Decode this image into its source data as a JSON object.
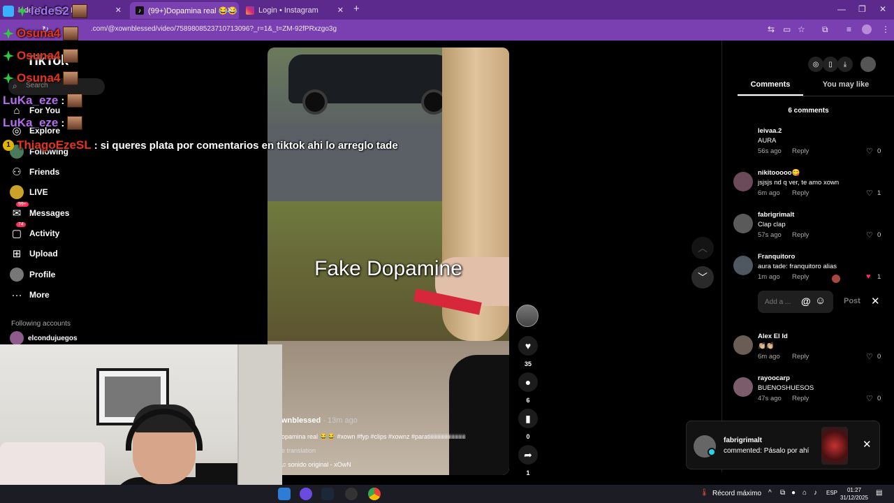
{
  "browser": {
    "tabs": [
      {
        "label": "ledeS2 · wlash L",
        "active": false
      },
      {
        "label": "(99+)Dopamina real 😂😂 #x",
        "active": true
      },
      {
        "label": "Login • Instagram",
        "active": false
      }
    ],
    "new_tab": "+",
    "url": ".com/@xownblessed/video/7589808523710713096?_r=1&_t=ZM-92fPRxzgo3g",
    "window_controls": [
      "—",
      "❐",
      "✕"
    ]
  },
  "chat": [
    {
      "name": "ledeS2",
      "color": "#a970ff",
      "message": ""
    },
    {
      "name": "Osuna4",
      "color": "#e6341c",
      "message": ""
    },
    {
      "name": "Osuna4",
      "color": "#e6341c",
      "message": ""
    },
    {
      "name": "Osuna4",
      "color": "#e6341c",
      "message": ""
    },
    {
      "name": "LuKa_eze",
      "color": "#b66cf0",
      "message": ""
    },
    {
      "name": "LuKa_eze",
      "color": "#b66cf0",
      "message": ""
    },
    {
      "name": "ThiagoEzeSL",
      "color": "#e6341c",
      "message": "si queres plata por comentarios en tiktok ahi lo arreglo tade"
    }
  ],
  "tiktok": {
    "logo": "TikTok",
    "search_placeholder": "Search",
    "nav": [
      {
        "label": "For You",
        "icon": "home-icon"
      },
      {
        "label": "Explore",
        "icon": "compass-icon"
      },
      {
        "label": "Following",
        "icon": "following-icon"
      },
      {
        "label": "Friends",
        "icon": "friends-icon"
      },
      {
        "label": "LIVE",
        "icon": "live-icon"
      },
      {
        "label": "Messages",
        "icon": "messages-icon",
        "badge": "99+"
      },
      {
        "label": "Activity",
        "icon": "activity-icon",
        "badge": "74"
      },
      {
        "label": "Upload",
        "icon": "upload-icon"
      },
      {
        "label": "Profile",
        "icon": "profile-icon"
      },
      {
        "label": "More",
        "icon": "more-icon"
      }
    ],
    "following_accounts_label": "Following accounts",
    "following_account": "elcondujuegos"
  },
  "video": {
    "overlay_text": "Fake Dopamine",
    "author": "wnblessed",
    "time_ago": "· 13m ago",
    "description": "opamina real 😂😂 #xown #fyp #clips #xownz #paratiiiiiiiiiiiiiiiiiiiiiiiiii",
    "translation": "e translation",
    "sound": "♫ sonido original - xOwN"
  },
  "actions": {
    "likes": "35",
    "comments": "6",
    "saves": "0",
    "shares": "1"
  },
  "panel": {
    "tabs": [
      "Comments",
      "You may like"
    ],
    "comment_count": "6 comments",
    "comments": [
      {
        "user": "leivaa.2",
        "text": "AURA",
        "time": "56s ago",
        "reply": "Reply",
        "likes": "0",
        "liked": false,
        "avatar_color": "#000000"
      },
      {
        "user": "nikitooooo😋",
        "text": "jsjsjs nd q ver, te amo xown",
        "time": "6m ago",
        "reply": "Reply",
        "likes": "1",
        "liked": false,
        "avatar_color": "#6b4a5a"
      },
      {
        "user": "fabrigrimalt",
        "text": "Clap clap",
        "time": "57s ago",
        "reply": "Reply",
        "likes": "0",
        "liked": false,
        "avatar_color": "#5a5a5a"
      },
      {
        "user": "Franquitoro",
        "text": "aura tade: franquitoro alias",
        "time": "1m ago",
        "reply": "Reply",
        "likes": "1",
        "liked": true,
        "avatar_color": "#4f5761"
      },
      {
        "user": "Alex El Id",
        "text": "👏🏼👏🏼",
        "time": "6m ago",
        "reply": "Reply",
        "likes": "0",
        "liked": false,
        "avatar_color": "#6a5d55"
      },
      {
        "user": "rayoocarp",
        "text": "BUENOSHUESOS",
        "time": "47s ago",
        "reply": "Reply",
        "likes": "0",
        "liked": false,
        "avatar_color": "#7a5c6a"
      }
    ],
    "input_placeholder": "Add a ...",
    "post_label": "Post"
  },
  "toast": {
    "user": "fabrigrimalt",
    "message": "commented: Pásalo por ahí"
  },
  "taskbar": {
    "weather": "Récord máximo",
    "lang": "ESP",
    "time": "01:27",
    "date": "31/12/2025"
  }
}
